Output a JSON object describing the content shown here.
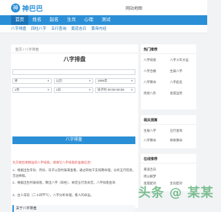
{
  "header": {
    "logo_glyph": "神",
    "logo_text": "神巴巴",
    "home_link": "网站地图"
  },
  "nav": {
    "items": [
      "首页",
      "姓名",
      "起名",
      "生肖",
      "心理",
      "测试"
    ]
  },
  "subnav": {
    "items": [
      "八字排盘",
      "四柱八字",
      "五行查询",
      "黄道吉日",
      "黄帝内经"
    ]
  },
  "main": {
    "breadcrumb": "首页 / 八字排盘",
    "title": "八字排盘",
    "form": {
      "name_value": "",
      "gender": "男",
      "calendar": "公历",
      "year": "1996年",
      "month": "1月",
      "day": "1日",
      "hour": "早子时 00:00-00:59"
    },
    "submit_label": "八字排盘",
    "note": "为方便您更精准的八字排盘，请填写八字排盘的准确信息！",
    "paragraphs": [
      "1、根据出生年份、月份、日子以及时辰来查看，通过四柱干支排算命理，分析五行旺衰，吉凶祸福。",
      "2、根据出生时辰排盘，算出八字（四柱）、纳音五行及命宫，八字排盘查询",
      "3、古人常说（二十四节气），八字分析命理。看人的命运。"
    ],
    "section_title": "关于八字排盘"
  },
  "sidebar": {
    "box1": {
      "title": "热门推荐",
      "links": [
        "八字排盘",
        "八字十年大运",
        "八字合婚",
        "生辰八字",
        "八字算命",
        "八字起名",
        "周易八卦",
        "星座运势"
      ]
    },
    "box2": {
      "title": "相关测算",
      "links": [
        "生辰八字",
        "五行查询",
        "八字算命",
        "称骨算命"
      ]
    },
    "box3": {
      "title": "在线推荐",
      "links": [
        "黄道吉日",
        "周公解梦",
        "星座配对",
        "生肖配对"
      ]
    }
  },
  "watermark": "头条 @ 某某"
}
